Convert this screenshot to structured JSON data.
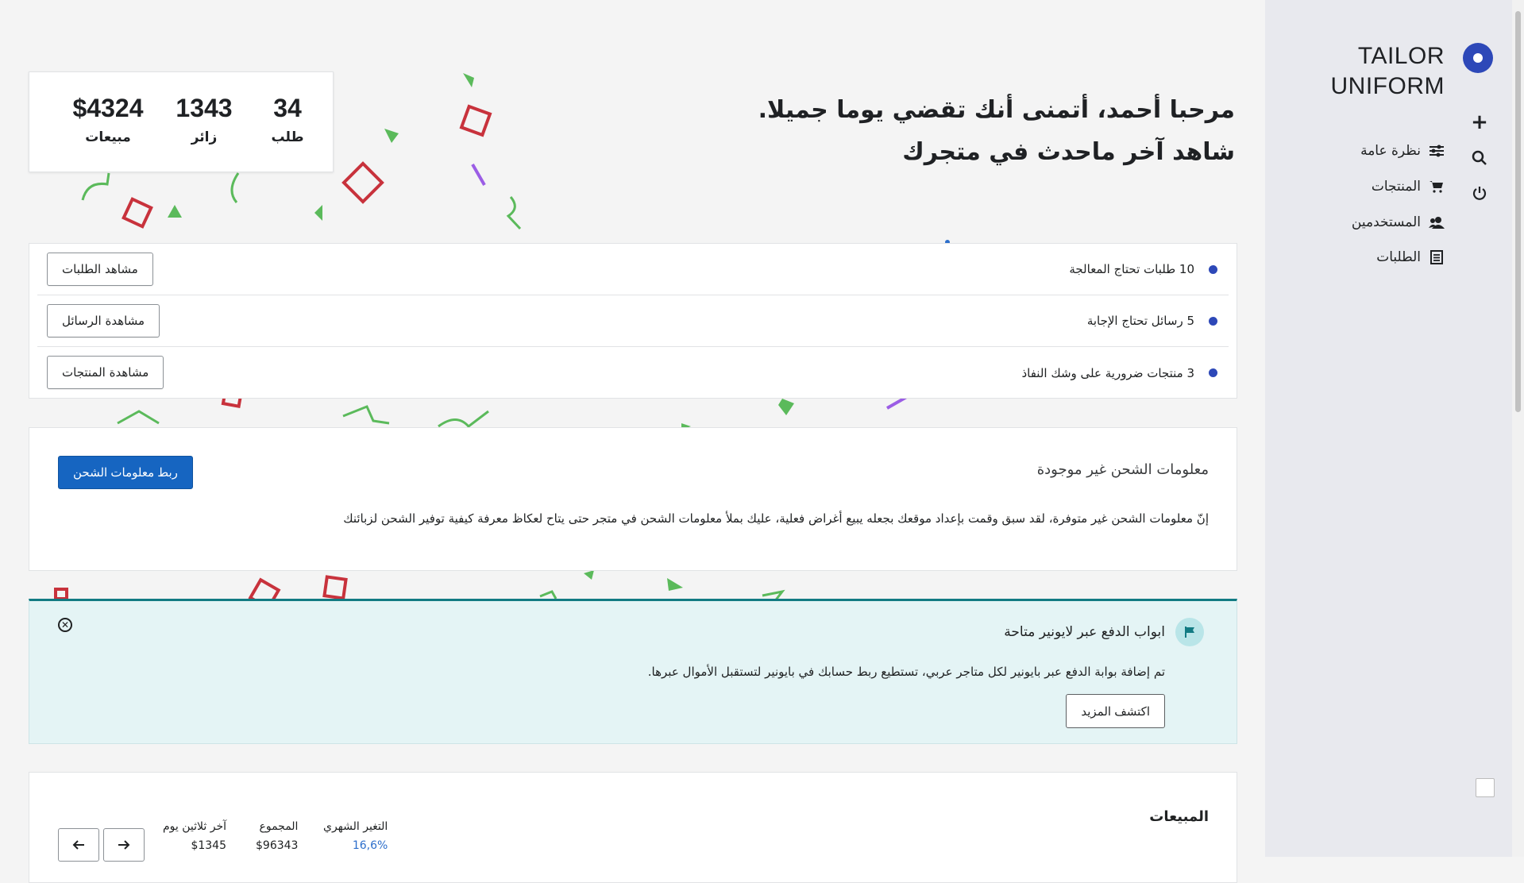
{
  "brand": {
    "line1": "TAILOR",
    "line2": "UNIFORM"
  },
  "sidebar": {
    "tools": [
      {
        "icon": "plus-icon",
        "symbol": "+"
      },
      {
        "icon": "search-icon",
        "symbol": "⌕"
      },
      {
        "icon": "power-icon",
        "symbol": "⏻"
      }
    ],
    "items": [
      {
        "label": "نظرة عامة",
        "icon": "sliders-icon",
        "symbol": "☰"
      },
      {
        "label": "المنتجات",
        "icon": "cart-icon",
        "symbol": "🛒"
      },
      {
        "label": "المستخدمين",
        "icon": "users-icon",
        "symbol": "👥"
      },
      {
        "label": "الطلبات",
        "icon": "list-icon",
        "symbol": "▤"
      }
    ]
  },
  "stats": {
    "orders": {
      "value": "34",
      "label": "طلب"
    },
    "visitors": {
      "value": "1343",
      "label": "زائر"
    },
    "sales": {
      "value": "$4324",
      "label": "مبيعات"
    }
  },
  "greeting": {
    "line1": "مرحبا أحمد، أتمنى أنك تقضي يوما جميلا.",
    "line2": "شاهد آخر ماحدث في متجرك"
  },
  "tasks": [
    {
      "text": "10 طلبات تحتاج المعالجة",
      "button": "مشاهد الطلبات"
    },
    {
      "text": "5 رسائل تحتاج الإجابة",
      "button": "مشاهدة الرسائل"
    },
    {
      "text": "3 منتجات ضرورية على وشك النفاذ",
      "button": "مشاهدة المنتجات"
    }
  ],
  "shipping": {
    "title": "معلومات الشحن غير موجودة",
    "button": "ربط معلومات الشحن",
    "description": "إنّ معلومات الشحن غير متوفرة، لقد سبق وقمت بإعداد موقعك بجعله يبيع أغراض فعلية، عليك بملأ معلومات الشحن في متجر حتى يتاح لعكاظ معرفة كيفية توفير الشحن لزبائنك"
  },
  "banner": {
    "title": "ابواب الدفع عبر لايونير متاحة",
    "description": "تم إضافة بوابة الدفع عبر بايونير لكل متاجر عربي، تستطيع ربط حسابك في بايونير لتستقبل الأموال عبرها.",
    "button": "اكتشف المزيد",
    "accent": "#127b83"
  },
  "sales_card": {
    "title": "المبيعات",
    "metrics": [
      {
        "label": "التغير الشهري",
        "value": "16,6%"
      },
      {
        "label": "المجموع",
        "value": "$96343"
      },
      {
        "label": "آخر ثلاثين يوم",
        "value": "$1345"
      }
    ]
  },
  "colors": {
    "primary": "#2d48b8",
    "button_blue": "#1665c1",
    "sidebar_bg": "#e8e9ee"
  }
}
